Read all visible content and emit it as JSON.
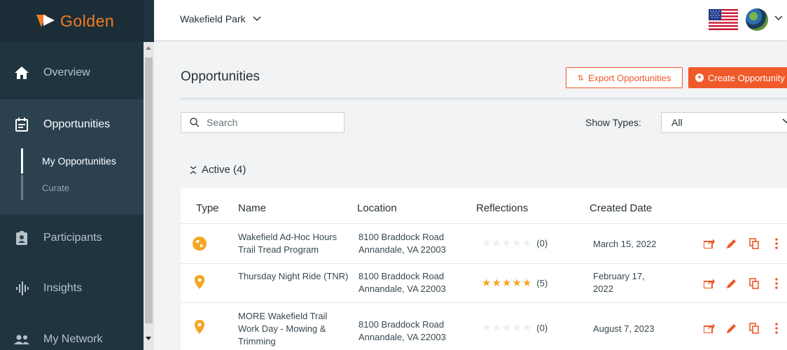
{
  "brand": {
    "name": "Golden"
  },
  "sidebar": {
    "items": [
      {
        "label": "Overview",
        "icon": "home-icon"
      },
      {
        "label": "Opportunities",
        "icon": "calendar-icon"
      },
      {
        "label": "Participants",
        "icon": "badge-icon"
      },
      {
        "label": "Insights",
        "icon": "waveform-icon"
      },
      {
        "label": "My Network",
        "icon": "people-icon"
      }
    ],
    "subitems": [
      {
        "label": "My Opportunities"
      },
      {
        "label": "Curate"
      }
    ]
  },
  "topbar": {
    "site_name": "Wakefield Park",
    "flag": "us-flag-icon",
    "avatar": "user-avatar"
  },
  "main": {
    "title": "Opportunities",
    "export_label": "Export Opportunities",
    "create_label": "Create Opportunity",
    "search_placeholder": "Search",
    "show_types_label": "Show Types:",
    "show_types_value": "All",
    "active_section": "Active (4)"
  },
  "table": {
    "headers": [
      "Type",
      "Name",
      "Location",
      "Reflections",
      "Created Date"
    ],
    "rows": [
      {
        "type": "globe-icon",
        "name": "Wakefield Ad-Hoc Hours Trail Tread Program",
        "location": "8100 Braddock Road Annandale, VA 22003",
        "rating": 0,
        "reflection_count": "(0)",
        "created": "March 15, 2022"
      },
      {
        "type": "map-pin-icon",
        "name": "Thursday Night Ride (TNR)",
        "location": "8100 Braddock Road Annandale, VA 22003",
        "rating": 5,
        "reflection_count": "(5)",
        "created": "February 17, 2022"
      },
      {
        "type": "map-pin-icon",
        "name": "MORE Wakefield Trail Work Day - Mowing & Trimming",
        "location": "8100 Braddock Road Annandale, VA 22003",
        "rating": 0,
        "reflection_count": "(0)",
        "created": "August 7, 2023"
      }
    ]
  },
  "colors": {
    "accent": "#f0592a",
    "icon_orange": "#f5a623",
    "sidebar": "#1f3440"
  }
}
